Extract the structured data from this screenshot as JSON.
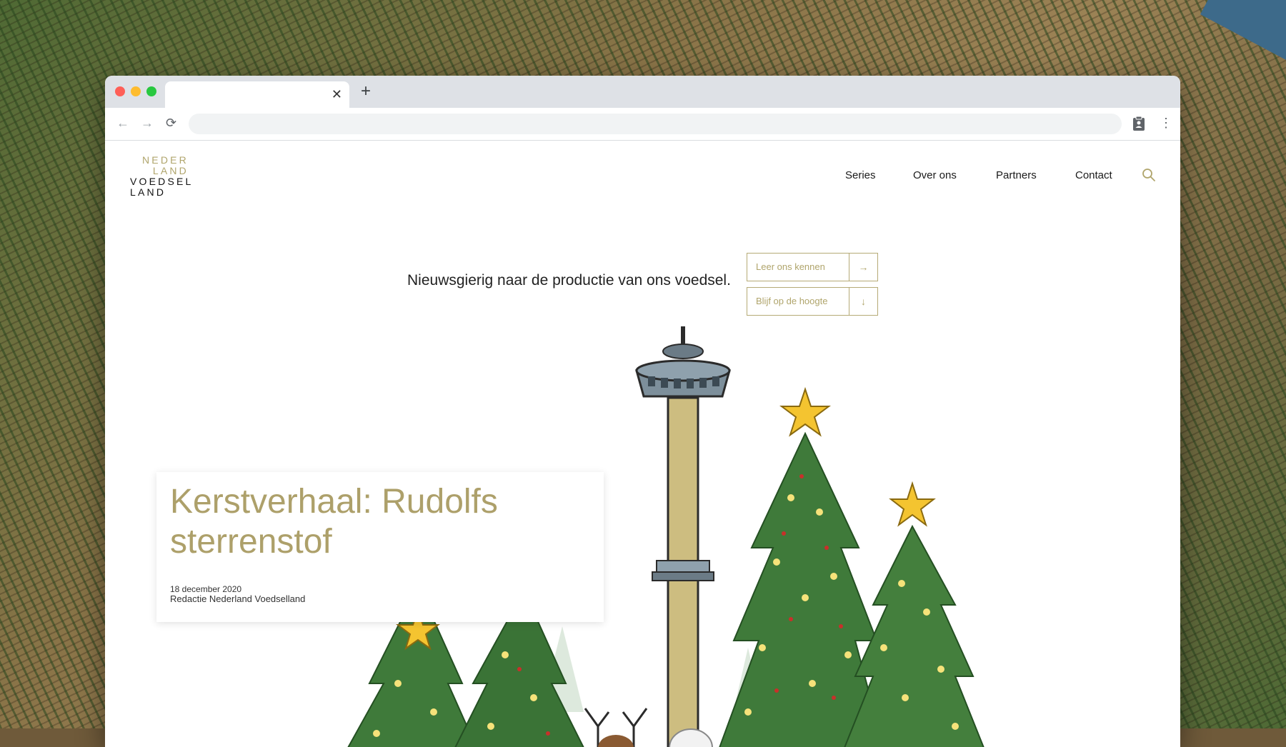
{
  "browser": {
    "tab_title": "",
    "tab_close": "✕",
    "new_tab": "+",
    "back": "←",
    "forward": "→",
    "reload": "⟳",
    "address": "",
    "menu": "⋮"
  },
  "site": {
    "logo": {
      "line1": "NEDER",
      "line2": "LAND",
      "line3": "VOEDSEL",
      "line4": "LAND"
    },
    "nav": {
      "series": "Series",
      "over_ons": "Over ons",
      "partners": "Partners",
      "contact": "Contact"
    }
  },
  "hero": {
    "tagline": "Nieuwsgierig naar de productie van ons voedsel.",
    "cta_primary": {
      "label": "Leer ons kennen",
      "arrow": "→"
    },
    "cta_secondary": {
      "label": "Blijf op de hoogte",
      "arrow": "↓"
    }
  },
  "article": {
    "title": "Kerstverhaal: Rudolfs sterrenstof",
    "date": "18 december 2020",
    "author": "Redactie Nederland Voedselland"
  },
  "colors": {
    "brand_gold": "#b0a56c",
    "text_dark": "#1a1a1a",
    "tree_green": "#3f7a3a",
    "star_yellow": "#f4c430"
  },
  "icons": [
    "close-icon",
    "plus-icon",
    "back-arrow-icon",
    "forward-arrow-icon",
    "reload-icon",
    "clipboard-icon",
    "kebab-menu-icon",
    "search-icon",
    "arrow-right-icon",
    "arrow-down-icon"
  ]
}
